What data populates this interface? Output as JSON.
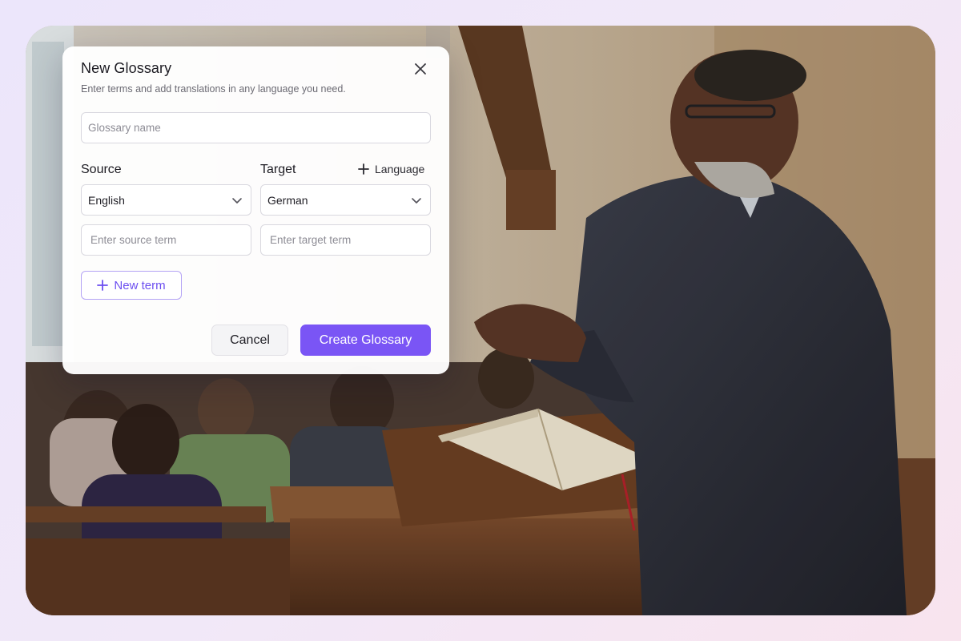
{
  "dialog": {
    "title": "New Glossary",
    "subtitle": "Enter terms and add translations in any language you need.",
    "close_icon": "close-icon",
    "glossary_name_placeholder": "Glossary name",
    "source_label": "Source",
    "target_label": "Target",
    "add_language_label": "Language",
    "add_language_icon": "plus-icon",
    "source_language": "English",
    "target_language": "German",
    "dropdown_icon": "chevron-down-icon",
    "source_term_placeholder": "Enter source term",
    "target_term_placeholder": "Enter target term",
    "new_term_label": "New term",
    "cancel_label": "Cancel",
    "create_label": "Create Glossary"
  },
  "colors": {
    "accent": "#7a55f5",
    "accent_border": "#b4a3f5",
    "background_gradient_start": "#ece6fb",
    "background_gradient_end": "#f8e4ee"
  },
  "background_image": "church-sermon-photo"
}
